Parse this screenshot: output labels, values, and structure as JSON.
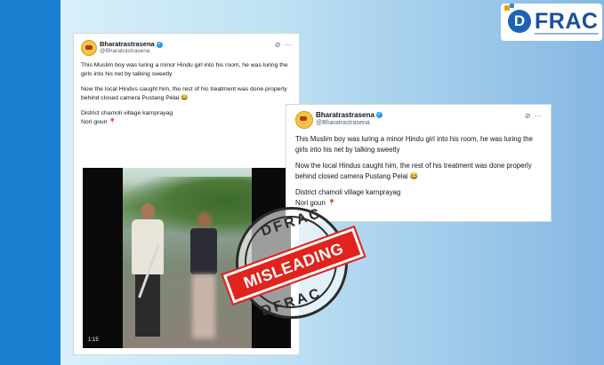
{
  "logo": {
    "text": "FRAC",
    "letter": "D",
    "brand_color": "#1b4f9c"
  },
  "tweet_left": {
    "name": "Bharatrastrasena",
    "handle": "@Bharatrastrasena",
    "verified_icon": "verified-badge-icon",
    "paragraphs": [
      "This Muslim boy was luring a minor Hindu girl into his room, he was luring the girls into his net by talking sweetly",
      "Now the local Hindus caught him, the rest of his treatment was done properly behind closed camera Pustang Pelai 😂",
      "District chamoli village karnprayag\nNori goun 📍"
    ],
    "video_time": "1:15"
  },
  "tweet_right": {
    "name": "Bharatrastrasena",
    "handle": "@Bharatrastrasena",
    "verified_icon": "verified-badge-icon",
    "paragraphs": [
      "This Muslim boy was luring a minor Hindu girl into his room, he was luring the girls into his net by talking sweetly",
      "Now the local Hindus caught him, the rest of his treatment was done properly behind closed camera Pustang Pelai 😂",
      "District chamoli village karnprayag\nNori goun 📍"
    ]
  },
  "stamp": {
    "top_text": "DFRAC",
    "bottom_text": "DFRAC",
    "label": "MISLEADING",
    "label_color": "#e0231c"
  }
}
